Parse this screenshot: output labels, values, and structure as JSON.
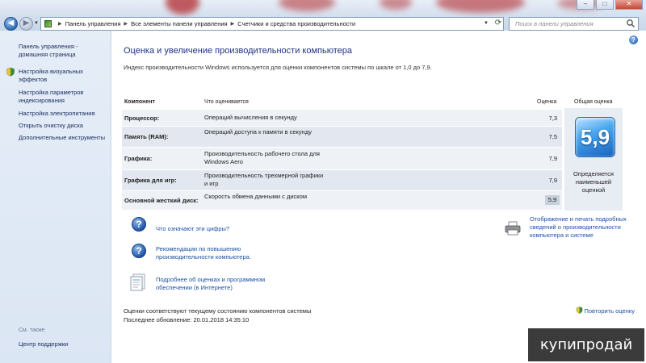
{
  "window": {
    "minimize": "–",
    "maximize": "□",
    "close": "✕"
  },
  "address": {
    "breadcrumbs": [
      "Панель управления",
      "Все элементы панели управления",
      "Счетчики и средства производительности"
    ],
    "search_placeholder": "Поиск в панели управления"
  },
  "sidebar": {
    "home": "Панель управления - домашняя страница",
    "items": [
      "Настройка визуальных эффектов",
      "Настройка параметров индексирования",
      "Настройка электропитания",
      "Открыть очистку диска",
      "Дополнительные инструменты"
    ],
    "see_also": "См. также",
    "support": "Центр поддержки"
  },
  "main": {
    "title": "Оценка и увеличение производительности компьютера",
    "intro": "Индекс производительности Windows используется для оценки компонентов системы по шкале от 1,0 до 7,9.",
    "table": {
      "headers": {
        "component": "Компонент",
        "what": "Что оценивается",
        "score": "Оценка",
        "base": "Общая оценка"
      },
      "rows": [
        {
          "component": "Процессор:",
          "what": "Операций вычисления в секунду",
          "score": "7,3"
        },
        {
          "component": "Память (RAM):",
          "what": "Операций доступа к памяти в секунду",
          "score": "7,5"
        },
        {
          "component": "Графика:",
          "what": "Производительность рабочего стола для Windows Aero",
          "score": "7,9"
        },
        {
          "component": "Графика для игр:",
          "what": "Производительность трехмерной графики и игр",
          "score": "7,9"
        },
        {
          "component": "Основной жесткий диск:",
          "what": "Скорость обмена данными с диском",
          "score": "5,9"
        }
      ],
      "base_score": "5,9",
      "base_caption": "Определяется наименьшей оценкой"
    },
    "links": {
      "what_mean": "Что означают эти цифры?",
      "tips": "Рекомендации по повышению производительности компьютера.",
      "online": "Подробнее об оценках и программном обеспечении (в Интернете)",
      "print": "Отображение и печать подробных сведений о производительности компьютера и системе"
    },
    "footer": {
      "current": "Оценки соответствуют текущему состоянию компонентов системы",
      "updated": "Последнее обновление: 20.01.2018 14:35:10",
      "rerun": "Повторить оценку"
    }
  },
  "watermark": "купипродай",
  "colors": {
    "link": "#1b50a5",
    "title": "#1e3287",
    "sidebar_bg": "#dbe6f4",
    "badge": "#1662bd"
  }
}
